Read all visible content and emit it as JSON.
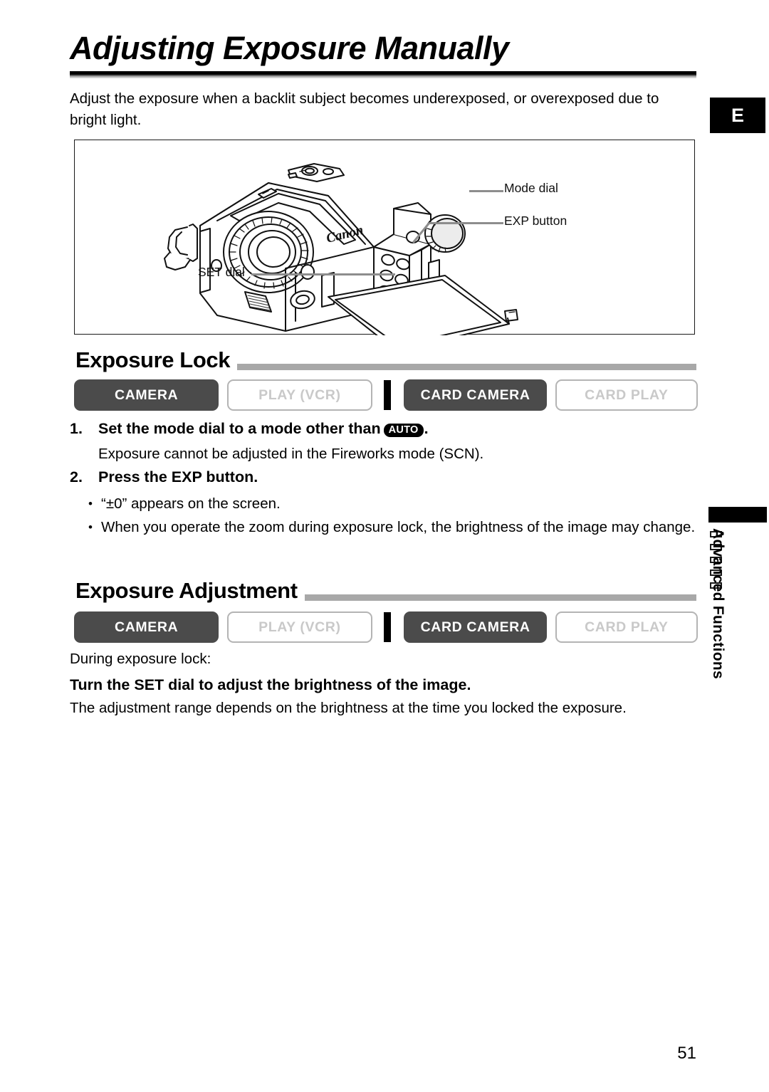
{
  "page": {
    "title": "Adjusting Exposure Manually",
    "intro": "Adjust the exposure when a backlit subject becomes underexposed, or overexposed due to bright light.",
    "number": "51",
    "language_tab": "E"
  },
  "figure": {
    "callouts": [
      {
        "name": "mode-dial",
        "label": "Mode dial"
      },
      {
        "name": "exp-button",
        "label": "EXP button"
      },
      {
        "name": "set-dial",
        "label": "SET dial"
      }
    ],
    "device_brand": "Canon"
  },
  "sections": [
    {
      "heading": "Exposure Lock",
      "badges": [
        {
          "label": "CAMERA",
          "state": "on"
        },
        {
          "label": "PLAY (VCR)",
          "state": "off"
        },
        {
          "label": "CARD CAMERA",
          "state": "on"
        },
        {
          "label": "CARD PLAY",
          "state": "off"
        }
      ],
      "steps": [
        {
          "number": "1.",
          "text_before": "Set the mode dial to a mode other than",
          "icon_label": "AUTO",
          "text_after": ".",
          "note": "Exposure cannot be adjusted in the Fireworks mode (SCN)."
        },
        {
          "number": "2.",
          "text_before": "Press the EXP button.",
          "bullets": [
            "“±0” appears on the screen.",
            "When you operate the zoom during exposure lock, the brightness of the image may change."
          ]
        }
      ]
    },
    {
      "heading": "Exposure Adjustment",
      "badges": [
        {
          "label": "CAMERA",
          "state": "on"
        },
        {
          "label": "PLAY (VCR)",
          "state": "off"
        },
        {
          "label": "CARD CAMERA",
          "state": "on"
        },
        {
          "label": "CARD PLAY",
          "state": "off"
        }
      ],
      "lead_in": "During exposure lock:",
      "instruction": "Turn the SET dial to adjust the brightness of the image.",
      "note": "The adjustment range depends on the brightness at the time you locked the exposure."
    }
  ],
  "side_tab": {
    "label": "Advanced Functions",
    "mark_count": 5
  },
  "colors": {
    "badge_active_bg": "#4b4b4b",
    "badge_inactive_border": "#b4b4b4",
    "badge_inactive_text": "#c9c9c9",
    "section_rule": "#a8a8a8",
    "leader_line": "#8d8d8d",
    "tab_bg": "#000000"
  }
}
